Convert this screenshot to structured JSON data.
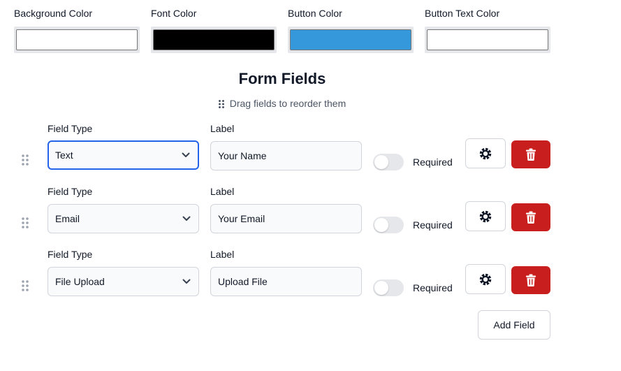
{
  "colors": {
    "background": {
      "label": "Background Color",
      "value": "#ffffff"
    },
    "font": {
      "label": "Font Color",
      "value": "#000000"
    },
    "button": {
      "label": "Button Color",
      "value": "#3498db"
    },
    "button_text": {
      "label": "Button Text Color",
      "value": "#ffffff"
    }
  },
  "form": {
    "title": "Form Fields",
    "hint": "Drag fields to reorder them",
    "fields": [
      {
        "type_label": "Field Type",
        "type_value": "Text",
        "label_label": "Label",
        "label_value": "Your Name",
        "required_label": "Required",
        "required": false,
        "focused": true
      },
      {
        "type_label": "Field Type",
        "type_value": "Email",
        "label_label": "Label",
        "label_value": "Your Email",
        "required_label": "Required",
        "required": false,
        "focused": false
      },
      {
        "type_label": "Field Type",
        "type_value": "File Upload",
        "label_label": "Label",
        "label_value": "Upload File",
        "required_label": "Required",
        "required": false,
        "focused": false
      }
    ],
    "add_button": "Add Field"
  },
  "theme": {
    "delete": "#c81e1e",
    "focus": "#2563eb"
  },
  "icons": {
    "drag": "drag-handle-icon",
    "settings": "gear-icon",
    "delete": "trash-icon",
    "select": "chevron-down-icon"
  }
}
